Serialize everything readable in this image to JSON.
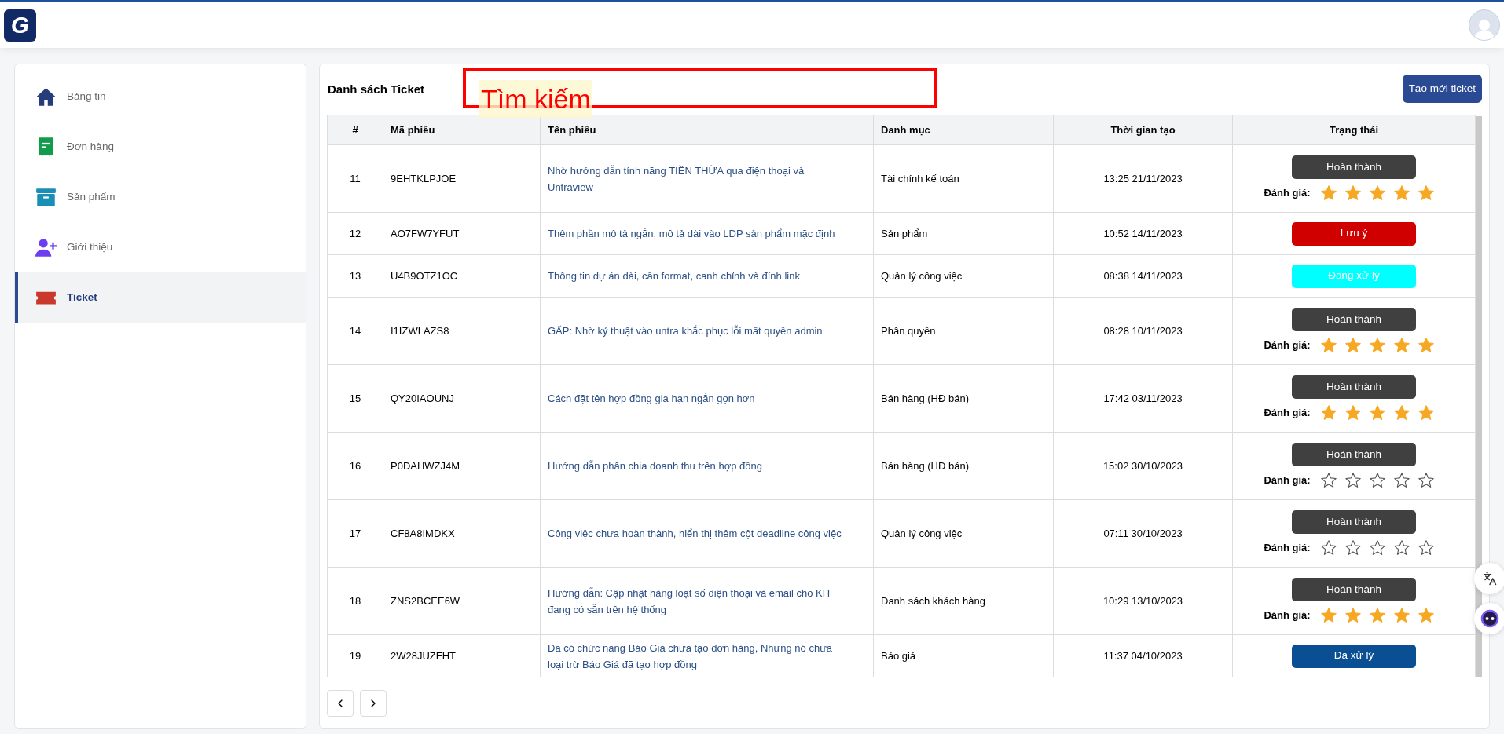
{
  "header": {
    "logo_text": "G"
  },
  "sidebar": {
    "items": [
      {
        "label": "Bảng tin",
        "kind": "home",
        "selected": false
      },
      {
        "label": "Đơn hàng",
        "kind": "receipt",
        "selected": false
      },
      {
        "label": "Sản phẩm",
        "kind": "archive",
        "selected": false
      },
      {
        "label": "Giới thiệu",
        "kind": "user",
        "selected": false
      },
      {
        "label": "Ticket",
        "kind": "ticket",
        "selected": true
      }
    ]
  },
  "main": {
    "title": "Danh sách Ticket",
    "annotation": {
      "label": "Tìm kiếm"
    },
    "create_button": "Tạo mới ticket",
    "table": {
      "columns": [
        "#",
        "Mã phiếu",
        "Tên phiếu",
        "Danh mục",
        "Thời gian tạo",
        "Trạng thái"
      ],
      "rows": [
        {
          "no": "11",
          "code": "9EHTKLPJOE",
          "name": "Nhờ hướng dẫn tính năng TIỀN THỪA qua điện thoại và Untraview",
          "category": "Tài chính kế toán",
          "created": "13:25 21/11/2023",
          "status": {
            "label": "Hoàn thành",
            "color": "#404040"
          },
          "rating": {
            "label": "Đánh giá:",
            "stars": 5
          }
        },
        {
          "no": "12",
          "code": "AO7FW7YFUT",
          "name": "Thêm phần mô tả ngắn, mô tả dài vào LDP sản phẩm mặc định",
          "category": "Sản phẩm",
          "created": "10:52 14/11/2023",
          "status": {
            "label": "Lưu ý",
            "color": "#d00000"
          }
        },
        {
          "no": "13",
          "code": "U4B9OTZ1OC",
          "name": "Thông tin dự án dài, cần format, canh chỉnh và đính link",
          "category": "Quản lý công việc",
          "created": "08:38 14/11/2023",
          "status": {
            "label": "Đang xử lý",
            "color": "#00ffff"
          }
        },
        {
          "no": "14",
          "code": "I1IZWLAZS8",
          "name": "GẤP: Nhờ kỷ thuật vào untra khắc phục lỗi mất quyền admin",
          "category": "Phân quyền",
          "created": "08:28 10/11/2023",
          "status": {
            "label": "Hoàn thành",
            "color": "#404040"
          },
          "rating": {
            "label": "Đánh giá:",
            "stars": 5
          }
        },
        {
          "no": "15",
          "code": "QY20IAOUNJ",
          "name": "Cách đặt tên hợp đồng gia hạn ngắn gọn hơn",
          "category": "Bán hàng (HĐ bán)",
          "created": "17:42 03/11/2023",
          "status": {
            "label": "Hoàn thành",
            "color": "#404040"
          },
          "rating": {
            "label": "Đánh giá:",
            "stars": 5
          }
        },
        {
          "no": "16",
          "code": "P0DAHWZJ4M",
          "name": "Hướng dẫn phân chia doanh thu trên hợp đồng",
          "category": "Bán hàng (HĐ bán)",
          "created": "15:02 30/10/2023",
          "status": {
            "label": "Hoàn thành",
            "color": "#404040"
          },
          "rating": {
            "label": "Đánh giá:",
            "stars": 0
          }
        },
        {
          "no": "17",
          "code": "CF8A8IMDKX",
          "name": "Công việc chưa hoàn thành, hiển thị thêm cột deadline công việc",
          "category": "Quản lý công việc",
          "created": "07:11 30/10/2023",
          "status": {
            "label": "Hoàn thành",
            "color": "#404040"
          },
          "rating": {
            "label": "Đánh giá:",
            "stars": 0
          }
        },
        {
          "no": "18",
          "code": "ZNS2BCEE6W",
          "name": "Hướng dẫn: Cập nhật hàng loạt số điện thoại và email cho KH đang có sẵn trên hệ thống",
          "category": "Danh sách khách hàng",
          "created": "10:29 13/10/2023",
          "status": {
            "label": "Hoàn thành",
            "color": "#404040"
          },
          "rating": {
            "label": "Đánh giá:",
            "stars": 5
          }
        },
        {
          "no": "19",
          "code": "2W28JUZFHT",
          "name": "Đã có chức năng Báo Giá chưa tạo đơn hàng, Nhưng nó chưa loại trừ Báo Giá đã tạo hợp đồng",
          "category": "Báo giá",
          "created": "11:37 04/10/2023",
          "status": {
            "label": "Đã xử lý",
            "color": "#0a4f94"
          }
        }
      ]
    }
  }
}
